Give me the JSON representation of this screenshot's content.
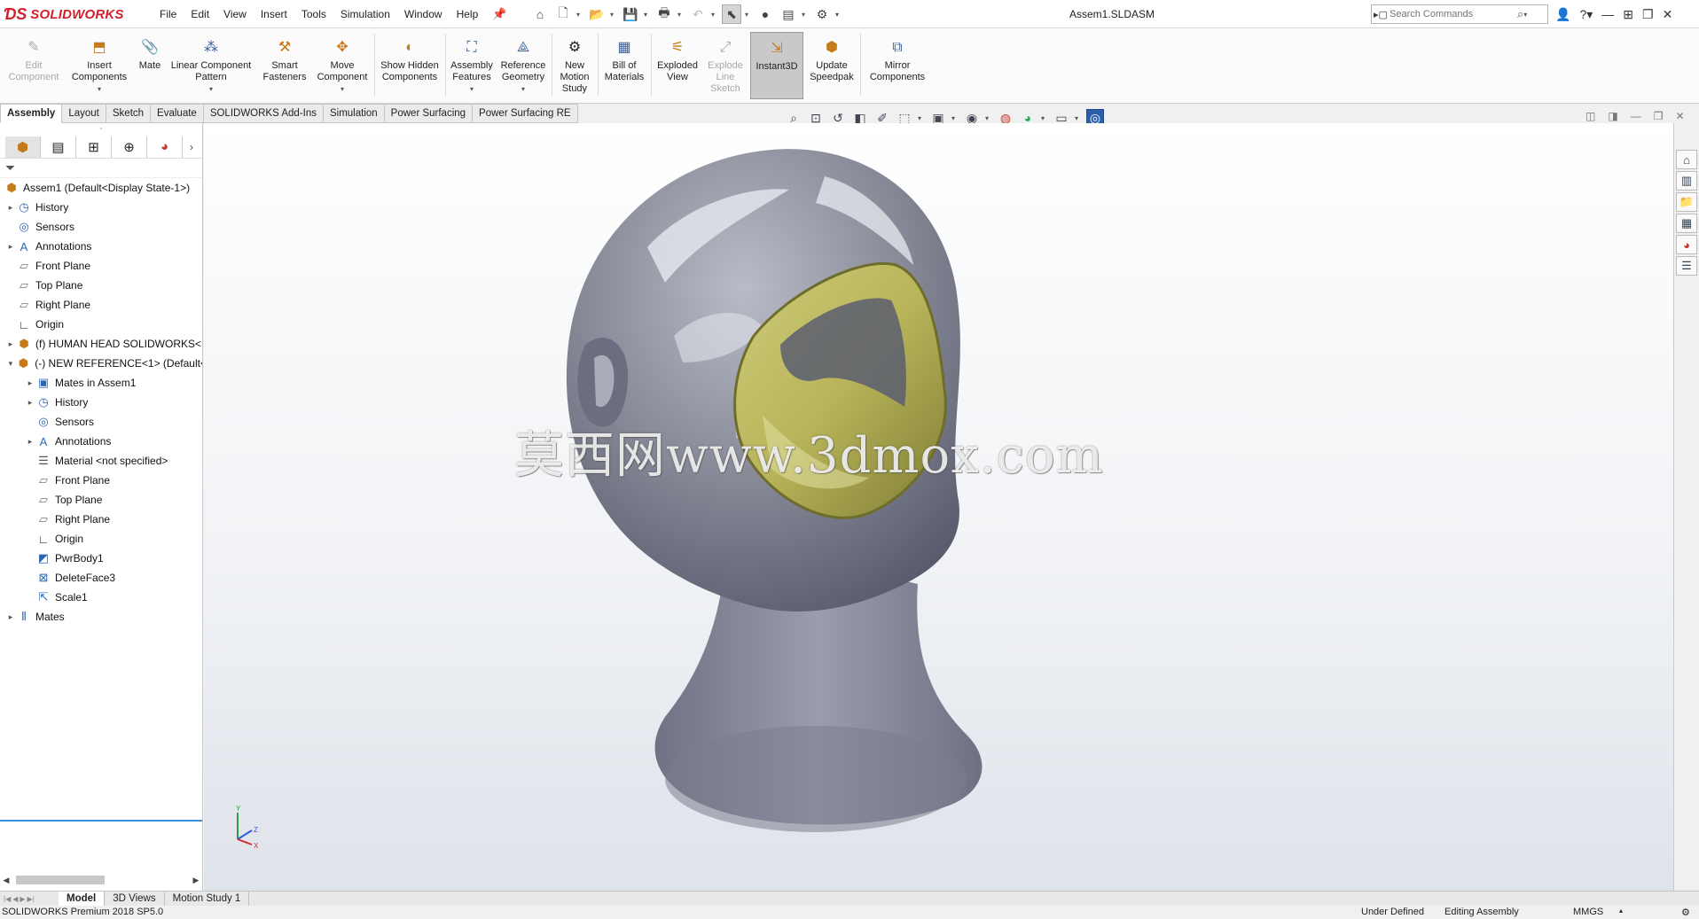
{
  "app": {
    "logo_text": "SOLIDWORKS",
    "document_title": "Assem1.SLDASM"
  },
  "menu": [
    "File",
    "Edit",
    "View",
    "Insert",
    "Tools",
    "Simulation",
    "Window",
    "Help"
  ],
  "search": {
    "placeholder": "Search Commands"
  },
  "ribbon": {
    "buttons": [
      {
        "label": "Edit Component",
        "icon": "edit-component-icon",
        "enabled": false
      },
      {
        "label": "Insert Components",
        "icon": "insert-components-icon",
        "enabled": true
      },
      {
        "label": "Mate",
        "icon": "paperclip-icon",
        "enabled": true
      },
      {
        "label": "Linear Component Pattern",
        "icon": "pattern-icon",
        "enabled": true
      },
      {
        "label": "Smart Fasteners",
        "icon": "fasteners-icon",
        "enabled": true
      },
      {
        "label": "Move Component",
        "icon": "move-component-icon",
        "enabled": true
      },
      {
        "label": "Show Hidden Components",
        "icon": "show-hidden-icon",
        "enabled": true
      },
      {
        "label": "Assembly Features",
        "icon": "assembly-features-icon",
        "enabled": true
      },
      {
        "label": "Reference Geometry",
        "icon": "reference-geometry-icon",
        "enabled": true
      },
      {
        "label": "New Motion Study",
        "icon": "motion-study-icon",
        "enabled": true
      },
      {
        "label": "Bill of Materials",
        "icon": "bom-icon",
        "enabled": true
      },
      {
        "label": "Exploded View",
        "icon": "exploded-view-icon",
        "enabled": true
      },
      {
        "label": "Explode Line Sketch",
        "icon": "explode-line-icon",
        "enabled": false
      },
      {
        "label": "Instant3D",
        "icon": "instant3d-icon",
        "enabled": true,
        "active": true
      },
      {
        "label": "Update Speedpak",
        "icon": "speedpak-icon",
        "enabled": true
      },
      {
        "label": "Mirror Components",
        "icon": "mirror-icon",
        "enabled": true
      }
    ]
  },
  "tabs": [
    "Assembly",
    "Layout",
    "Sketch",
    "Evaluate",
    "SOLIDWORKS Add-Ins",
    "Simulation",
    "Power Surfacing",
    "Power Surfacing RE"
  ],
  "active_tab": "Assembly",
  "tree": {
    "root": "Assem1  (Default<Display State-1>)",
    "items": [
      {
        "label": "History"
      },
      {
        "label": "Sensors"
      },
      {
        "label": "Annotations"
      },
      {
        "label": "Front Plane"
      },
      {
        "label": "Top Plane"
      },
      {
        "label": "Right Plane"
      },
      {
        "label": "Origin"
      },
      {
        "label": "(f) HUMAN HEAD SOLIDWORKS<"
      },
      {
        "label": "(-) NEW REFERENCE<1> (Default<"
      },
      {
        "label": "Mates in Assem1"
      },
      {
        "label": "History"
      },
      {
        "label": "Sensors"
      },
      {
        "label": "Annotations"
      },
      {
        "label": "Material <not specified>"
      },
      {
        "label": "Front Plane"
      },
      {
        "label": "Top Plane"
      },
      {
        "label": "Right Plane"
      },
      {
        "label": "Origin"
      },
      {
        "label": "PwrBody1"
      },
      {
        "label": "DeleteFace3"
      },
      {
        "label": "Scale1"
      },
      {
        "label": "Mates"
      }
    ]
  },
  "viewport": {
    "watermark": "莫西网www.3dmox.com",
    "triad": {
      "y": "Y",
      "z": "Z",
      "x": "X"
    },
    "head_color": "#8d909c",
    "mask_color": "#b7b45a"
  },
  "bottom_tabs": [
    "Model",
    "3D Views",
    "Motion Study 1"
  ],
  "active_bottom_tab": "Model",
  "status": {
    "version": "SOLIDWORKS Premium 2018 SP5.0",
    "definition": "Under Defined",
    "mode": "Editing Assembly",
    "units": "MMGS"
  }
}
